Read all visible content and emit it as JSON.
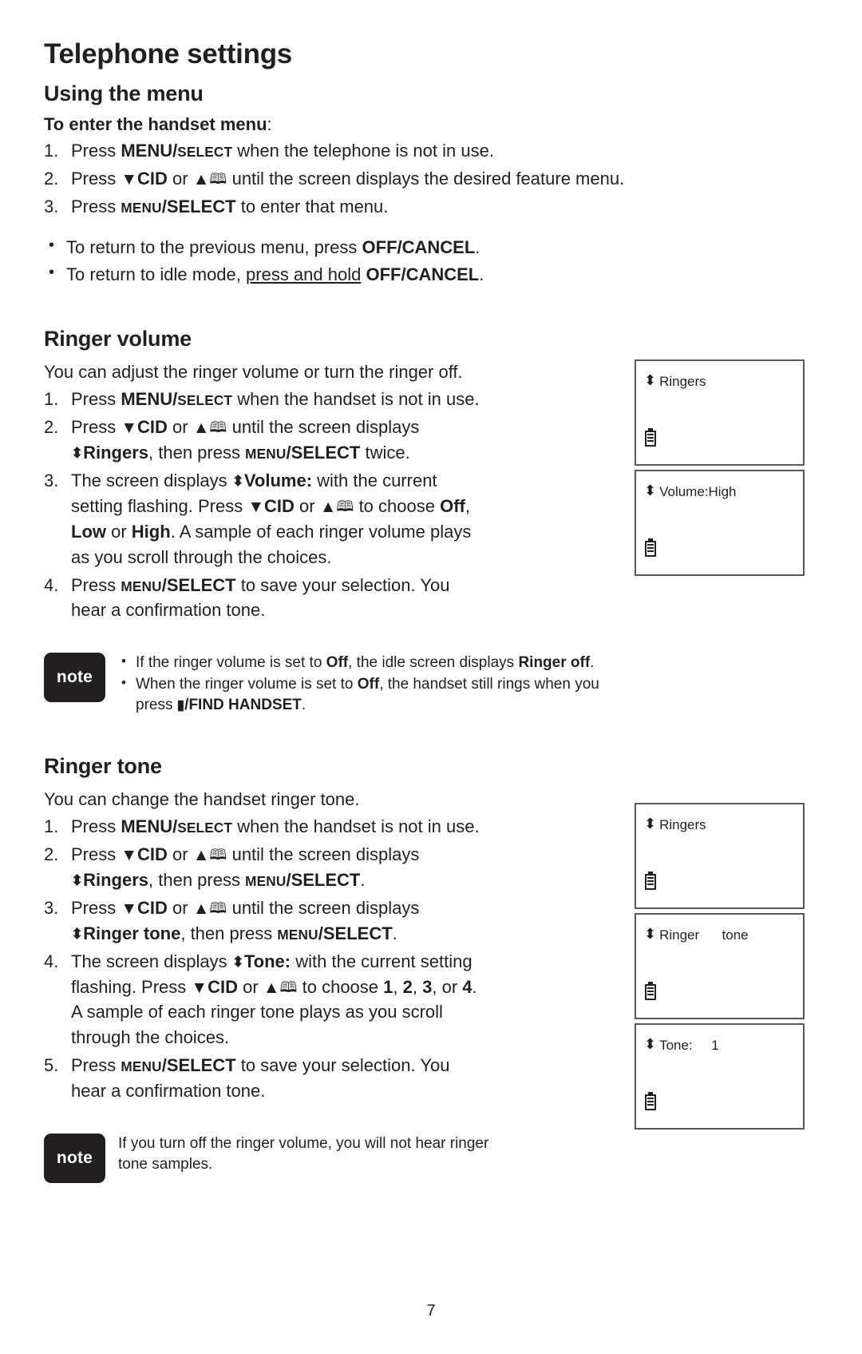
{
  "document": {
    "chapter_title": "Telephone settings",
    "page_number": "7"
  },
  "using_the_menu": {
    "heading": "Using the menu",
    "subheading_bold": "To enter the handset menu",
    "subheading_tail": ":",
    "steps": [
      {
        "num": "1.",
        "pre": "Press ",
        "key_big": "MENU",
        "key_sep": "/",
        "key_small": "SELECT",
        "post": " when the telephone is not in use."
      },
      {
        "num": "2.",
        "pre": "Press ",
        "down_arrow": "▼",
        "cid": "CID",
        "mid": " or ",
        "up_arrow": "▲",
        "book": "🕮",
        "post": " until the screen displays the desired feature menu."
      },
      {
        "num": "3.",
        "pre": "Press ",
        "key_small": "MENU",
        "key_sep": "/",
        "key_big": "SELECT",
        "post": " to enter that menu."
      }
    ],
    "bullets": [
      {
        "dot": "•",
        "pre": "To return to the previous menu, press ",
        "bold": "OFF/CANCEL",
        "post": "."
      },
      {
        "dot": "•",
        "pre": "To return to idle mode, ",
        "underline": "press and hold",
        "mid": " ",
        "bold": "OFF/CANCEL",
        "post": "."
      }
    ]
  },
  "ringer_volume": {
    "heading": "Ringer volume",
    "intro": "You can adjust the ringer volume or turn the ringer off.",
    "steps": [
      {
        "num": "1.",
        "pre": "Press ",
        "key_big": "MENU",
        "key_sep": "/",
        "key_small": "SELECT",
        "post": " when the handset is not in use."
      },
      {
        "num": "2.",
        "pre": "Press ",
        "down_arrow": "▼",
        "cid": "CID",
        "mid": " or ",
        "up_arrow": "▲",
        "book": "🕮",
        "post": " until the screen displays",
        "line2_updown": "⬍",
        "line2_bold": "Ringers",
        "line2_mid": ", then press ",
        "line2_key_small": "MENU",
        "line2_key_sep": "/",
        "line2_key_big": "SELECT",
        "line2_post": " twice."
      },
      {
        "num": "3.",
        "pre": "The screen displays ",
        "updown": "⬍",
        "bold1": "Volume:",
        "mid1": " with the current",
        "line2_pre": "setting flashing. Press ",
        "down_arrow": "▼",
        "cid": "CID",
        "line2_mid": " or ",
        "up_arrow": "▲",
        "book": "🕮",
        "line2_post": " to choose ",
        "opt1": "Off",
        "opt_sep1": ",",
        "line3_opt2": "Low",
        "line3_mid": " or ",
        "line3_opt3": "High",
        "line3_post": ". A sample of each ringer volume plays",
        "line4": "as you scroll through the choices."
      },
      {
        "num": "4.",
        "pre": "Press ",
        "key_small": "MENU",
        "key_sep": "/",
        "key_big": "SELECT",
        "post": " to save your selection. You",
        "line2": "hear a confirmation tone."
      }
    ],
    "note": {
      "badge": "note",
      "bullets": [
        {
          "dot": "•",
          "pre": "If the ringer volume is set to ",
          "bold1": "Off",
          "mid": ", the idle screen displays ",
          "bold2": "Ringer off",
          "post": "."
        },
        {
          "dot": "•",
          "pre": "When the ringer volume is set to ",
          "bold1": "Off",
          "mid": ", the handset still rings when you",
          "line2_pre": "press ",
          "handset_icon": "▮",
          "bold2": "/FIND HANDSET",
          "post": "."
        }
      ]
    },
    "screens": [
      {
        "updown": "⬍",
        "label": "Ringers",
        "battery": "battery-icon"
      },
      {
        "updown": "⬍",
        "label": "Volume:High",
        "battery": "battery-icon"
      }
    ]
  },
  "ringer_tone": {
    "heading": "Ringer tone",
    "intro": "You can change the handset ringer tone.",
    "steps": [
      {
        "num": "1.",
        "pre": "Press ",
        "key_big": "MENU",
        "key_sep": "/",
        "key_small": "SELECT",
        "post": " when the handset is not in use."
      },
      {
        "num": "2.",
        "pre": "Press ",
        "down_arrow": "▼",
        "cid": "CID",
        "mid": " or ",
        "up_arrow": "▲",
        "book": "🕮",
        "post": " until the screen displays",
        "line2_updown": "⬍",
        "line2_bold": "Ringers",
        "line2_mid": ", then press ",
        "line2_key_small": "MENU",
        "line2_key_sep": "/",
        "line2_key_big": "SELECT",
        "line2_post": "."
      },
      {
        "num": "3.",
        "pre": "Press ",
        "down_arrow": "▼",
        "cid": "CID",
        "mid": " or ",
        "up_arrow": "▲",
        "book": "🕮",
        "post": " until the screen displays",
        "line2_updown": "⬍",
        "line2_bold": "Ringer tone",
        "line2_mid": ", then press ",
        "line2_key_small": "MENU",
        "line2_key_sep": "/",
        "line2_key_big": "SELECT",
        "line2_post": "."
      },
      {
        "num": "4.",
        "pre": "The screen displays ",
        "updown": "⬍",
        "bold1": "Tone:",
        "mid1": " with the current setting",
        "line2_pre": "flashing. Press ",
        "down_arrow": "▼",
        "cid": "CID",
        "line2_mid": " or ",
        "up_arrow": "▲",
        "book": "🕮",
        "line2_post": " to choose ",
        "opt1": "1",
        "sep1": ", ",
        "opt2": "2",
        "sep2": ", ",
        "opt3": "3",
        "sep3": ", or ",
        "opt4": "4",
        "line2_end": ".",
        "line3": "A sample of each ringer tone plays as you scroll",
        "line4": "through the choices."
      },
      {
        "num": "5.",
        "pre": "Press ",
        "key_small": "MENU",
        "key_sep": "/",
        "key_big": "SELECT",
        "post": " to save your selection. You",
        "line2": "hear a confirmation tone."
      }
    ],
    "note": {
      "badge": "note",
      "line1": "If you turn off the ringer volume, you will not hear ringer",
      "line2": "tone samples."
    },
    "screens": [
      {
        "updown": "⬍",
        "label": "Ringers",
        "battery": "battery-icon"
      },
      {
        "updown": "⬍",
        "label": "Ringer      tone",
        "battery": "battery-icon"
      },
      {
        "updown": "⬍",
        "label": "Tone:     1",
        "battery": "battery-icon"
      }
    ]
  }
}
